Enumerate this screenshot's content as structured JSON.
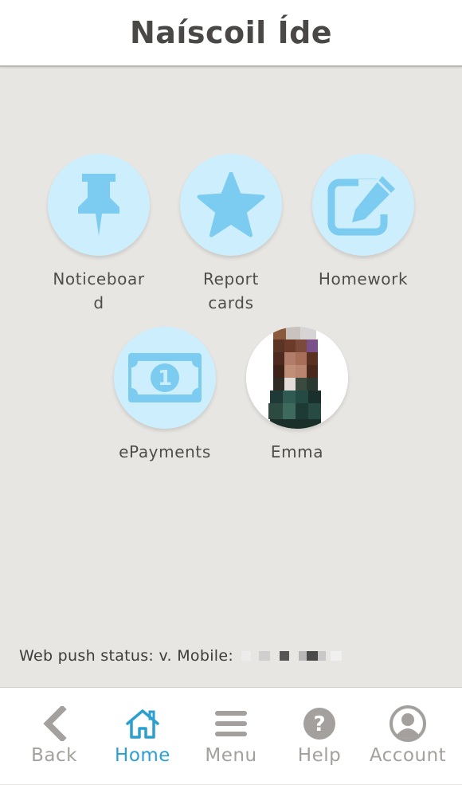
{
  "header": {
    "title": "Naíscoil Íde"
  },
  "tiles": [
    {
      "label": "Noticeboard",
      "icon": "pushpin-icon"
    },
    {
      "label": "Report cards",
      "icon": "star-icon"
    },
    {
      "label": "Homework",
      "icon": "edit-icon"
    },
    {
      "label": "ePayments",
      "icon": "banknote-icon"
    },
    {
      "label": "Emma",
      "icon": "child-avatar"
    }
  ],
  "status": {
    "text": "Web push status: v. Mobile:"
  },
  "tabbar": {
    "items": [
      {
        "label": "Back",
        "icon": "chevron-left-icon",
        "active": false
      },
      {
        "label": "Home",
        "icon": "home-icon",
        "active": true
      },
      {
        "label": "Menu",
        "icon": "hamburger-icon",
        "active": false
      },
      {
        "label": "Help",
        "icon": "help-icon",
        "active": false
      },
      {
        "label": "Account",
        "icon": "account-icon",
        "active": false
      }
    ]
  },
  "colors": {
    "accent": "#2a9fd0",
    "icon_blue": "#7ccbf0",
    "circle_bg": "#cdeefc",
    "inactive_tab": "#a3a09d",
    "page_bg": "#e8e6e3"
  }
}
